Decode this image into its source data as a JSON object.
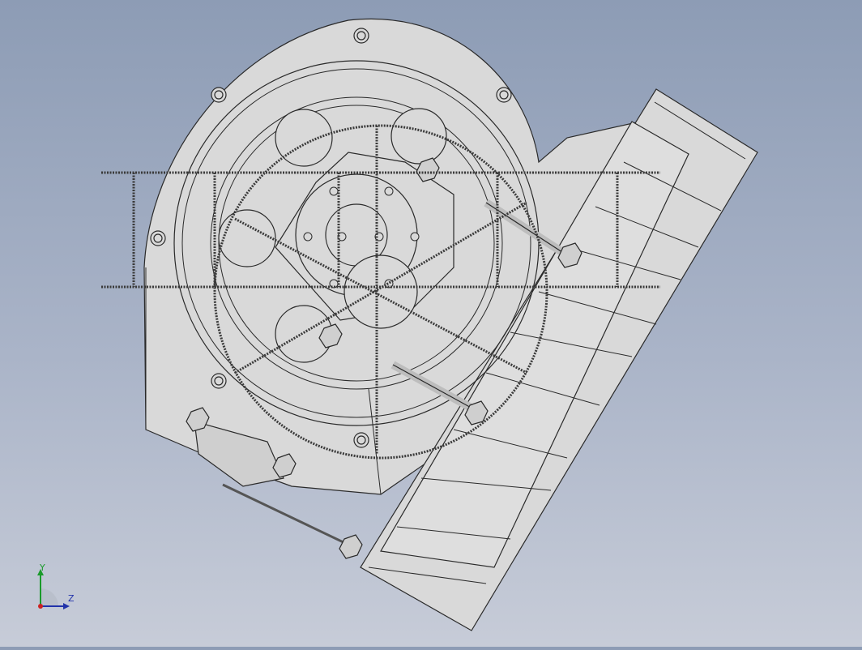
{
  "view": {
    "type": "cad-3d-model-viewport",
    "colors": {
      "background_top": "#8d9cb5",
      "background_bottom": "#c7ccd8",
      "part_fill": "#d9d9d9",
      "edge": "#2a2a2a",
      "rebar": "#3a3a3a",
      "axis_y": "#1a9a2a",
      "axis_z": "#2233aa",
      "axis_origin": "#cc2222"
    }
  },
  "triad": {
    "y_label": "Y",
    "z_label": "Z"
  }
}
